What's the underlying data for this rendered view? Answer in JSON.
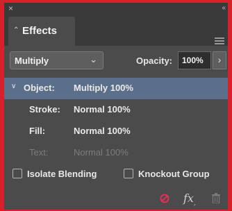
{
  "panel": {
    "title": "Effects",
    "close_glyph": "×",
    "collapse_glyph": "«",
    "tab_chevron": "⌃"
  },
  "blend_mode": {
    "value": "Multiply",
    "arrow": "⌄"
  },
  "opacity": {
    "label": "Opacity:",
    "value": "100%",
    "arrow": "›"
  },
  "attributes": [
    {
      "name": "Object:",
      "value": "Multiply 100%",
      "selected": true,
      "disabled": false
    },
    {
      "name": "Stroke:",
      "value": "Normal 100%",
      "selected": false,
      "disabled": false
    },
    {
      "name": "Fill:",
      "value": "Normal 100%",
      "selected": false,
      "disabled": false
    },
    {
      "name": "Text:",
      "value": "Normal 100%",
      "selected": false,
      "disabled": true
    }
  ],
  "attribute_disclosure": "∨",
  "checkboxes": {
    "isolate_blending": {
      "label": "Isolate Blending",
      "checked": false
    },
    "knockout_group": {
      "label": "Knockout Group",
      "checked": false
    }
  },
  "footer": {
    "fx_glyph": "fx"
  },
  "colors": {
    "frame": "#d8202b",
    "panel_bg": "#4b4b4b",
    "selected_row": "#5c6f8a",
    "clear_effects_icon": "#e0305a"
  },
  "icons": {
    "close": "close-icon",
    "collapse": "double-chevron-icon",
    "panel_menu": "hamburger-menu-icon",
    "clear_effects": "clear-effects-icon",
    "fx": "fx-icon",
    "delete": "trash-icon"
  }
}
